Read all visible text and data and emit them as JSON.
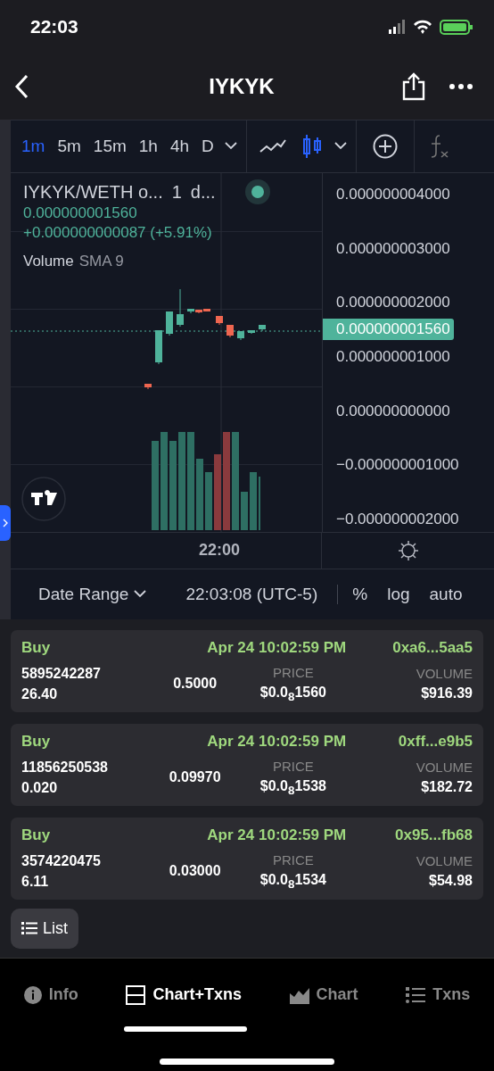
{
  "status_bar": {
    "time": "22:03"
  },
  "header": {
    "title": "IYKYK"
  },
  "intervals": [
    {
      "label": "1m",
      "selected": true
    },
    {
      "label": "5m",
      "selected": false
    },
    {
      "label": "15m",
      "selected": false
    },
    {
      "label": "1h",
      "selected": false
    },
    {
      "label": "4h",
      "selected": false
    },
    {
      "label": "D",
      "selected": false
    }
  ],
  "chart_types": [
    {
      "kind": "line",
      "selected": false
    },
    {
      "kind": "candles",
      "selected": true
    }
  ],
  "legend": {
    "symbol": "IYKYK/WETH o...",
    "interval": "1",
    "source": "d...",
    "price": "0.000000001560",
    "change": "+0.000000000087 (+5.91%)",
    "indicator": "Volume",
    "indicator_params": "SMA 9"
  },
  "price_axis": [
    "0.000000004000",
    "0.000000003000",
    "0.000000002000",
    "0.000000001000",
    "0.000000000000",
    "−0.000000001000",
    "−0.000000002000"
  ],
  "current_price": "0.000000001560",
  "time_axis": [
    "22:00"
  ],
  "bottom_toolbar": {
    "date_range": "Date Range",
    "clock": "22:03:08 (UTC-5)",
    "options": [
      "%",
      "log",
      "auto"
    ]
  },
  "transactions": [
    {
      "type": "Buy",
      "date": "Apr 24 10:02:59 PM",
      "address": "0xa6...5aa5",
      "tokens": "5895242287",
      "eth": "26.40",
      "col_3": "0.5000",
      "price_label": "PRICE",
      "price": "$0.0$_{8}$1560",
      "volume_label": "VOLUME",
      "volume": "$916.39"
    },
    {
      "type": "Buy",
      "date": "Apr 24 10:02:59 PM",
      "address": "0xff...e9b5",
      "tokens": "11856250538",
      "eth": "0.020",
      "col_3": "0.09970",
      "price_label": "PRICE",
      "price": "$0.0$_{8}$1538",
      "volume_label": "VOLUME",
      "volume": "$182.72"
    },
    {
      "type": "Buy",
      "date": "Apr 24 10:02:59 PM",
      "address": "0x95...fb68",
      "tokens": "3574220475",
      "eth": "6.11",
      "col_3": "0.03000",
      "price_label": "PRICE",
      "price": "$0.0$_{8}$1534",
      "volume_label": "VOLUME",
      "volume": "$54.98"
    }
  ],
  "list_button": "List",
  "tabs": [
    {
      "kind": "info",
      "label": "Info",
      "selected": false
    },
    {
      "kind": "split",
      "label": "Chart+Txns",
      "selected": true
    },
    {
      "kind": "chart",
      "label": "Chart",
      "selected": false
    },
    {
      "kind": "txns",
      "label": "Txns",
      "selected": false
    }
  ]
}
